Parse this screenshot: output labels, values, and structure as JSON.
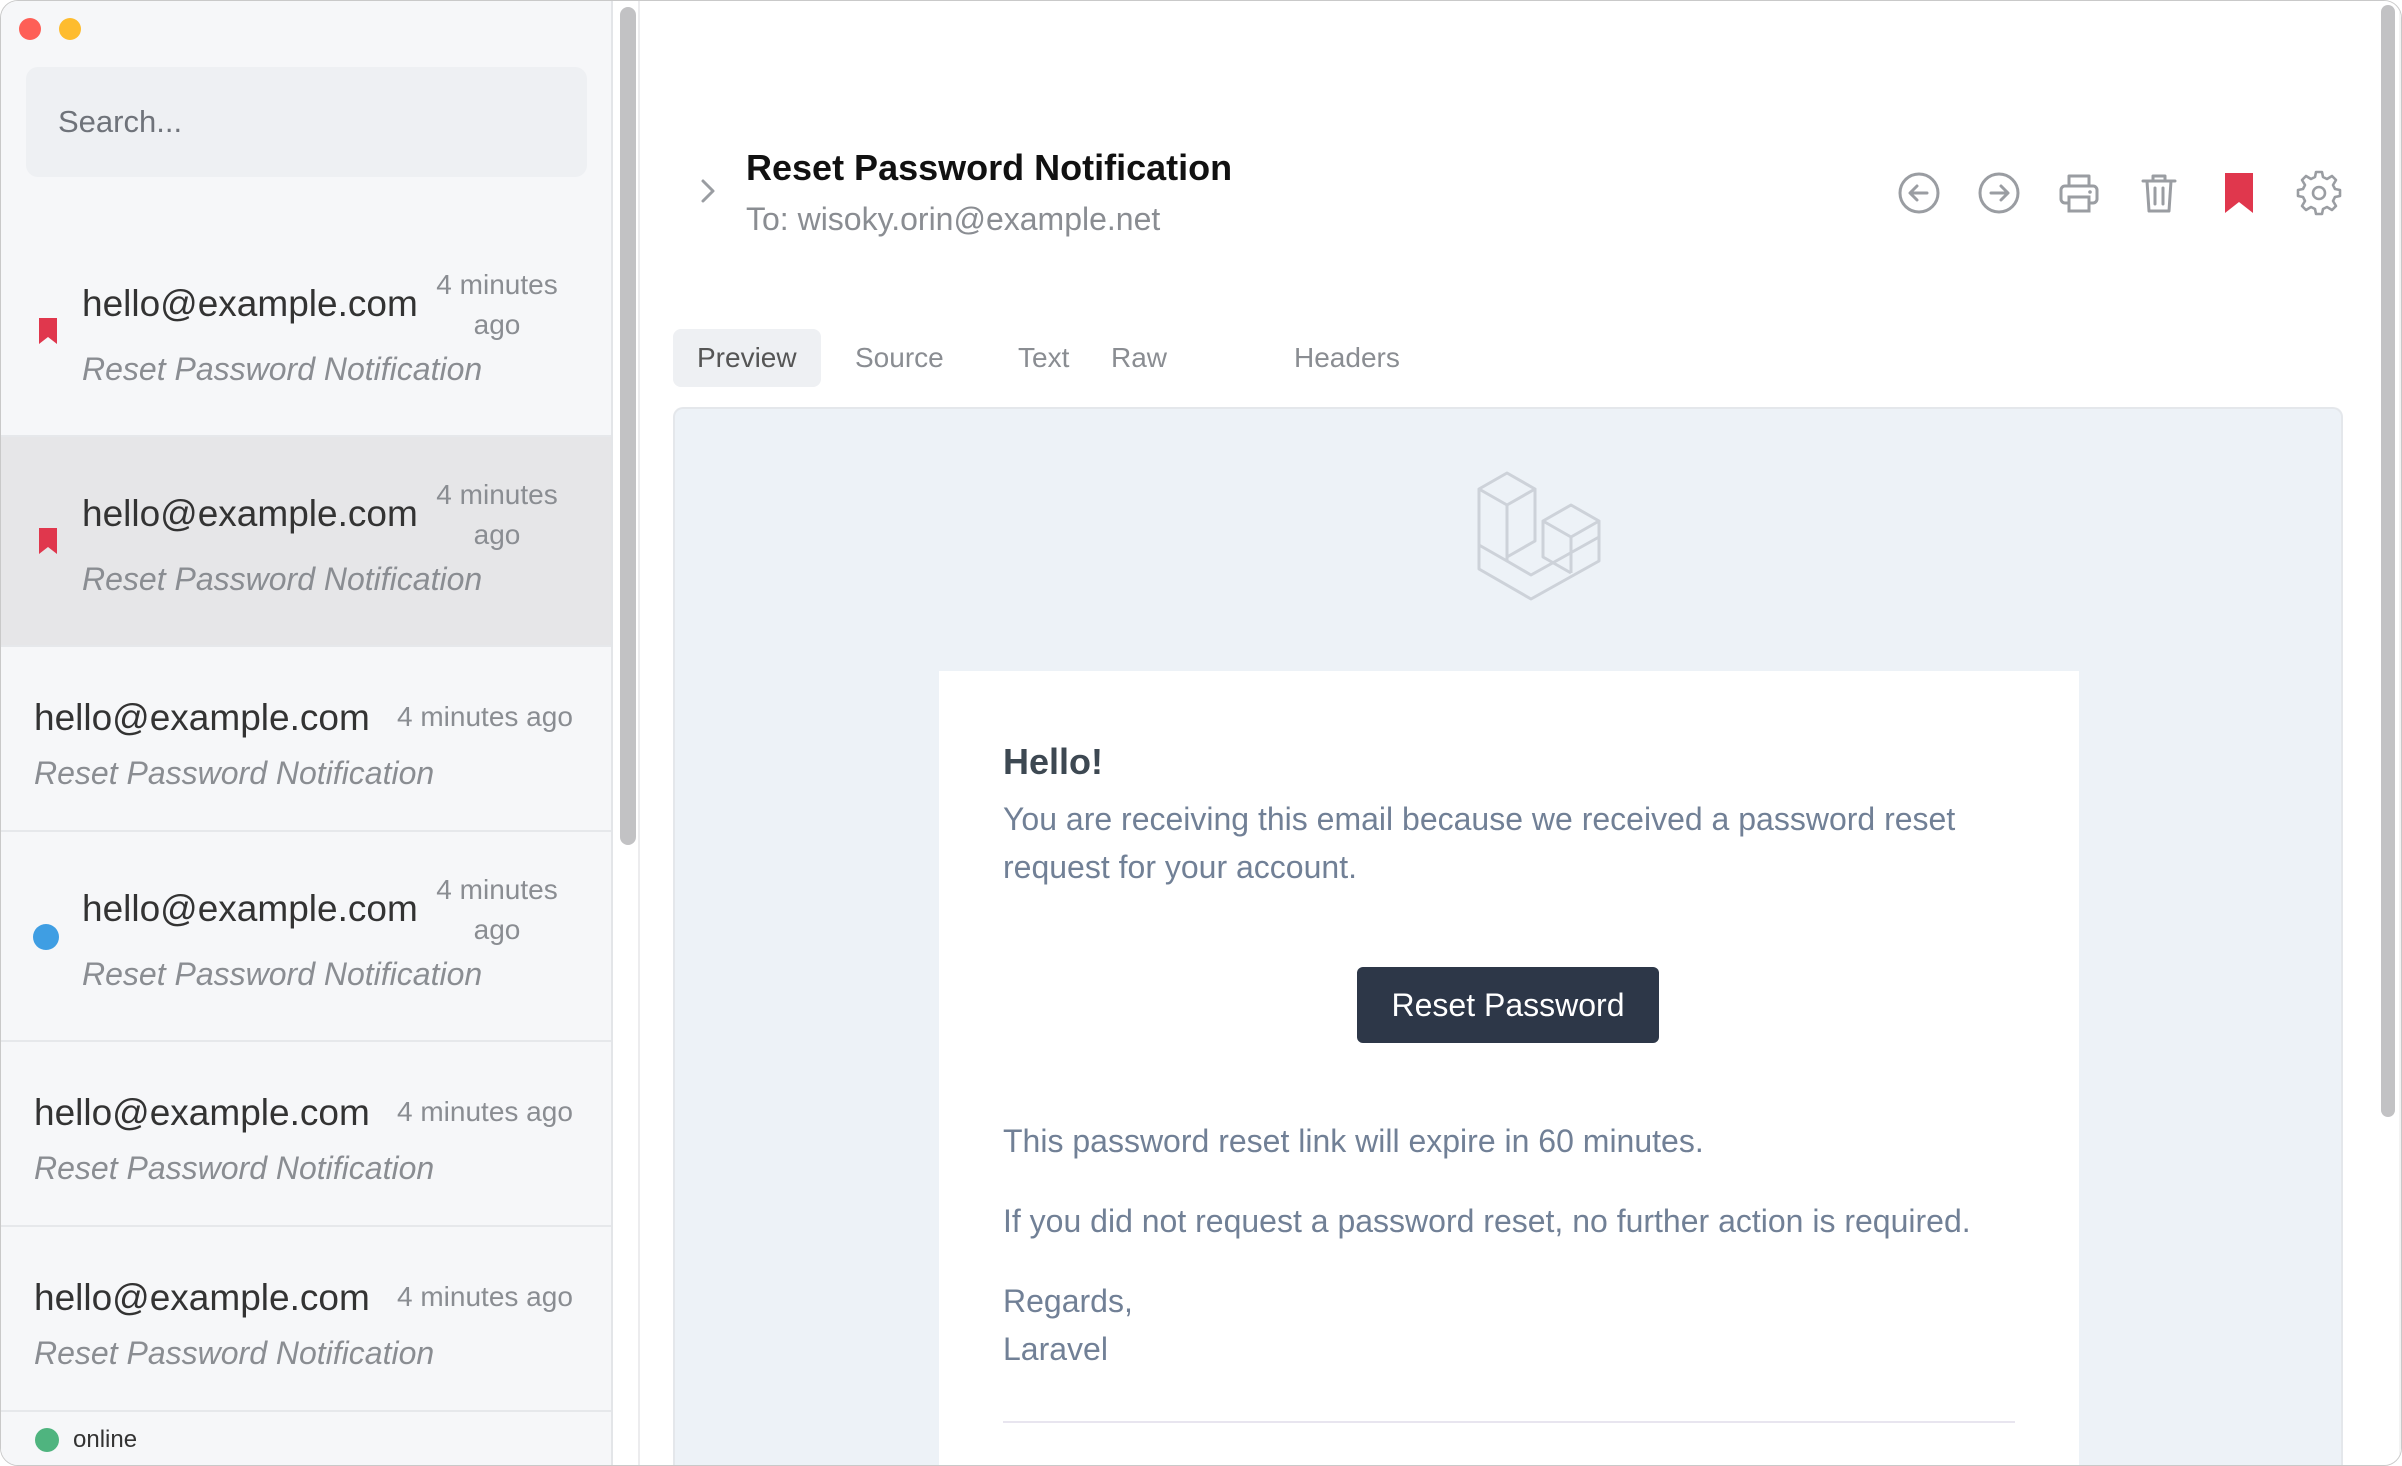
{
  "window": {
    "controls": [
      "close",
      "minimize"
    ]
  },
  "sidebar": {
    "search_placeholder": "Search...",
    "messages": [
      {
        "from": "hello@example.com",
        "time": "4 minutes ago",
        "subject": "Reset Password Notification",
        "marker": "bookmark",
        "selected": false
      },
      {
        "from": "hello@example.com",
        "time": "4 minutes ago",
        "subject": "Reset Password Notification",
        "marker": "bookmark",
        "selected": true
      },
      {
        "from": "hello@example.com",
        "time": "4 minutes ago",
        "subject": "Reset Password Notification",
        "marker": "none",
        "selected": false
      },
      {
        "from": "hello@example.com",
        "time": "4 minutes ago",
        "subject": "Reset Password Notification",
        "marker": "unread-dot",
        "selected": false
      },
      {
        "from": "hello@example.com",
        "time": "4 minutes ago",
        "subject": "Reset Password Notification",
        "marker": "none",
        "selected": false
      },
      {
        "from": "hello@example.com",
        "time": "4 minutes ago",
        "subject": "Reset Password Notification",
        "marker": "none",
        "selected": false
      }
    ],
    "status": "online"
  },
  "message": {
    "subject": "Reset Password Notification",
    "to": "To: wisoky.orin@example.net"
  },
  "toolbar": [
    "previous-message-icon",
    "next-message-icon",
    "print-icon",
    "trash-icon",
    "bookmark-icon",
    "gear-icon"
  ],
  "tabs": [
    "Preview",
    "Source",
    "Text",
    "Raw",
    "Headers"
  ],
  "active_tab": "Preview",
  "email": {
    "logo": "laravel-logo",
    "greeting": "Hello!",
    "intro": "You are receiving this email because we received a password reset request for your account.",
    "button": "Reset Password",
    "expire": "This password reset link will expire in 60 minutes.",
    "no_action": "If you did not request a password reset, no further action is required.",
    "regards": "Regards,",
    "signature": "Laravel"
  },
  "colors": {
    "bookmark": "#e0374d",
    "unread": "#3f9ee3",
    "online": "#4fb47f",
    "button": "#2d3748",
    "close": "#fe5f57",
    "minimize": "#febc2e"
  }
}
